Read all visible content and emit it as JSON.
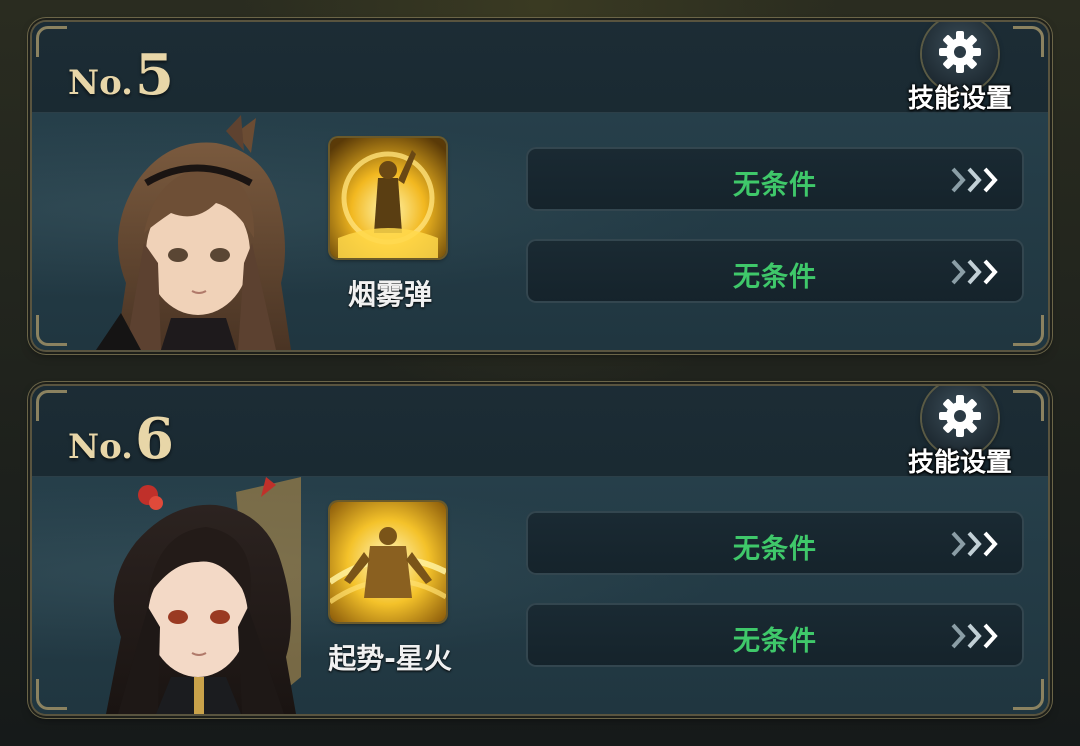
{
  "colors": {
    "panel_bg": "#1b2b33",
    "condition_text": "#3fc86a",
    "number_gold": "#e8d6a8",
    "frame_gold": "#8b8260"
  },
  "slots": [
    {
      "number_prefix": "No.",
      "number": "5",
      "settings_label": "技能设置",
      "settings_icon": "gear-icon",
      "portrait": "brown-haired-girl-portrait",
      "skill_icon": "smoke-bomb-skill-icon",
      "skill_name": "烟雾弹",
      "conditions": [
        "无条件",
        "无条件"
      ]
    },
    {
      "number_prefix": "No.",
      "number": "6",
      "settings_label": "技能设置",
      "settings_icon": "gear-icon",
      "portrait": "black-haired-girl-portrait",
      "skill_icon": "rising-spark-skill-icon",
      "skill_name": "起势-星火",
      "conditions": [
        "无条件",
        "无条件"
      ]
    }
  ]
}
